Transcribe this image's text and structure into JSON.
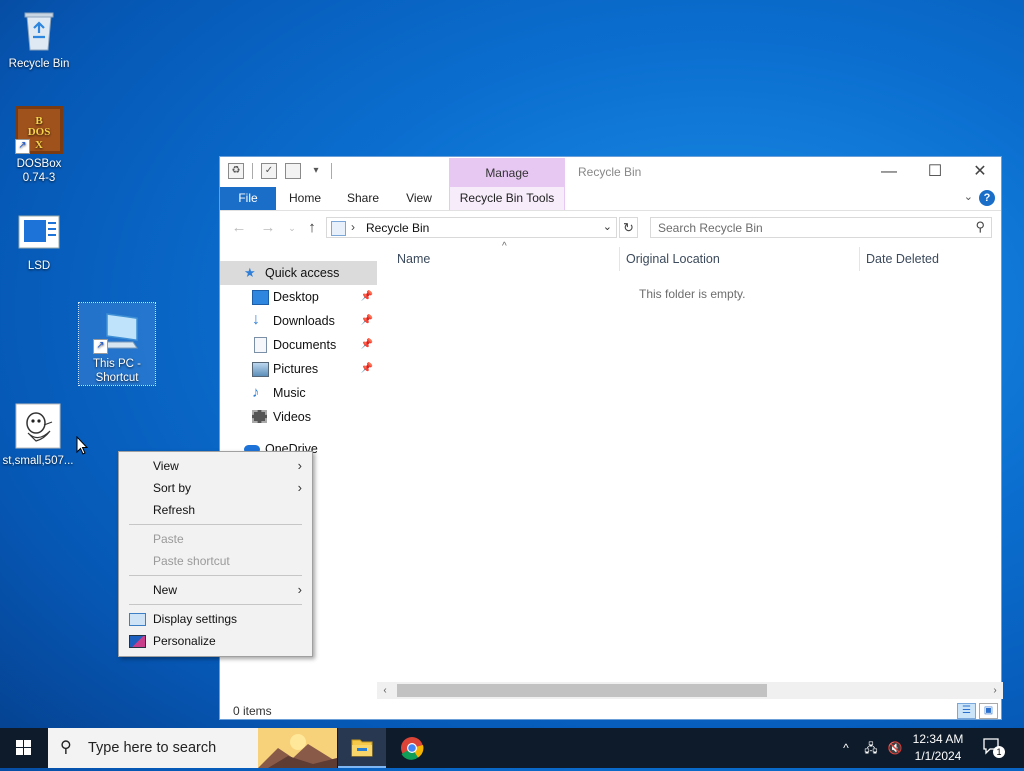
{
  "desktop": {
    "icons": [
      {
        "label": "Recycle Bin"
      },
      {
        "label": "DOSBox 0.74-3"
      },
      {
        "label": "LSD"
      },
      {
        "label": "This PC - Shortcut"
      },
      {
        "label": "st,small,507..."
      }
    ],
    "dosbox_logo_letters": "DOS BOX"
  },
  "explorer": {
    "title": "Recycle Bin",
    "manage_tab": "Manage",
    "ribbon_tabs": [
      "File",
      "Home",
      "Share",
      "View",
      "Recycle Bin Tools"
    ],
    "help": "?",
    "address": {
      "crumb": "Recycle Bin"
    },
    "search": {
      "placeholder": "Search Recycle Bin"
    },
    "nav": {
      "quick_access": "Quick access",
      "items": [
        {
          "label": "Desktop",
          "icon": "desktop-icon",
          "pinned": true
        },
        {
          "label": "Downloads",
          "icon": "downloads-icon",
          "pinned": true
        },
        {
          "label": "Documents",
          "icon": "documents-icon",
          "pinned": true
        },
        {
          "label": "Pictures",
          "icon": "pictures-icon",
          "pinned": true
        },
        {
          "label": "Music",
          "icon": "music-icon",
          "pinned": false
        },
        {
          "label": "Videos",
          "icon": "videos-icon",
          "pinned": false
        }
      ],
      "onedrive": "OneDrive"
    },
    "columns": [
      "Name",
      "Original Location",
      "Date Deleted"
    ],
    "empty_text": "This folder is empty.",
    "status": "0 items"
  },
  "context_menu": {
    "items": [
      {
        "label": "View",
        "submenu": true,
        "enabled": true
      },
      {
        "label": "Sort by",
        "submenu": true,
        "enabled": true
      },
      {
        "label": "Refresh",
        "submenu": false,
        "enabled": true
      },
      {
        "label": "Paste",
        "submenu": false,
        "enabled": false
      },
      {
        "label": "Paste shortcut",
        "submenu": false,
        "enabled": false
      },
      {
        "label": "New",
        "submenu": true,
        "enabled": true
      },
      {
        "label": "Display settings",
        "submenu": false,
        "enabled": true,
        "icon": "display-icon"
      },
      {
        "label": "Personalize",
        "submenu": false,
        "enabled": true,
        "icon": "personalize-icon"
      }
    ]
  },
  "taskbar": {
    "search_placeholder": "Type here to search",
    "clock_time": "12:34 AM",
    "clock_date": "1/1/2024",
    "notification_count": "1"
  },
  "colors": {
    "accent": "#1a6ec8",
    "manage_tab": "#e6c8f2",
    "taskbar": "#0e1b2a"
  }
}
